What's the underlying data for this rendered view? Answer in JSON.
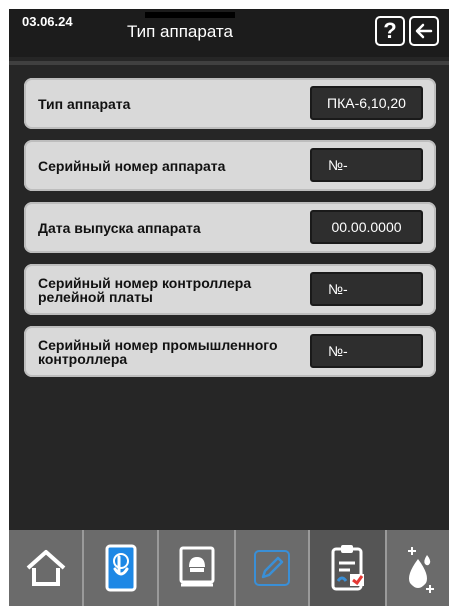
{
  "header": {
    "date": "03.06.24",
    "title": "Тип аппарата",
    "help_label": "?"
  },
  "rows": [
    {
      "label": "Тип аппарата",
      "value": "ПКА-6,10,20"
    },
    {
      "label": "Серийный номер аппарата",
      "value": "№-"
    },
    {
      "label": "Дата выпуска аппарата",
      "value": "00.00.0000"
    },
    {
      "label": "Серийный номер контроллера релейной платы",
      "value": "№-"
    },
    {
      "label": "Серийный номер промышленного контроллера",
      "value": "№-"
    }
  ],
  "toolbar": {
    "items": [
      {
        "icon": "home-icon"
      },
      {
        "icon": "touch-tablet-icon"
      },
      {
        "icon": "recipe-book-icon"
      },
      {
        "icon": "pencil-icon"
      },
      {
        "icon": "checklist-icon"
      },
      {
        "icon": "water-drops-icon"
      }
    ]
  },
  "colors": {
    "background": "#262626",
    "row": "#d9d9d9",
    "value_box": "#2e2e2e",
    "accent_blue": "#1e88e5"
  }
}
